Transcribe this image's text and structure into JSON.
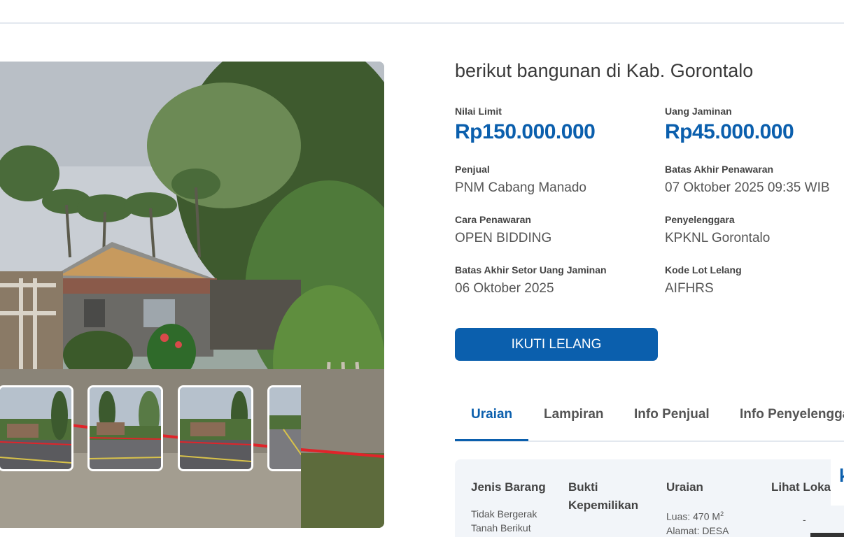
{
  "listing": {
    "title": "berikut bangunan di Kab. Gorontalo",
    "nilai_limit_label": "Nilai Limit",
    "nilai_limit_value": "Rp150.000.000",
    "uang_jaminan_label": "Uang Jaminan",
    "uang_jaminan_value": "Rp45.000.000",
    "fields": [
      {
        "label": "Penjual",
        "value": "PNM Cabang Manado"
      },
      {
        "label": "Batas Akhir Penawaran",
        "value": "07 Oktober 2025 09:35 WIB"
      },
      {
        "label": "Cara Penawaran",
        "value": "OPEN BIDDING"
      },
      {
        "label": "Penyelenggara",
        "value": "KPKNL Gorontalo"
      },
      {
        "label": "Batas Akhir Setor Uang Jaminan",
        "value": "06 Oktober 2025"
      },
      {
        "label": "Kode Lot Lelang",
        "value": "AIFHRS"
      }
    ],
    "cta_label": "IKUTI LELANG"
  },
  "tabs": [
    {
      "label": "Uraian",
      "active": true
    },
    {
      "label": "Lampiran",
      "active": false
    },
    {
      "label": "Info Penjual",
      "active": false
    },
    {
      "label": "Info Penyelenggara",
      "active": false
    }
  ],
  "detail_table": {
    "headers": [
      "Jenis Barang",
      "Bukti Kepemilikan",
      "Uraian",
      "Lihat Lokasi"
    ],
    "row": {
      "jenis_barang": "Tidak Bergerak Tanah Berikut",
      "uraian": "Luas: 470 M",
      "uraian_sup": "2",
      "uraian_line2": "Alamat: DESA",
      "lihat_lokasi": "-"
    },
    "edge_glyph": "k"
  },
  "colors": {
    "accent": "#0b5fad",
    "text_dark": "#3a3a3a",
    "divider": "#e3e8ef",
    "table_bg": "#f2f5f9"
  },
  "gallery": {
    "thumbnail_count": 4
  }
}
